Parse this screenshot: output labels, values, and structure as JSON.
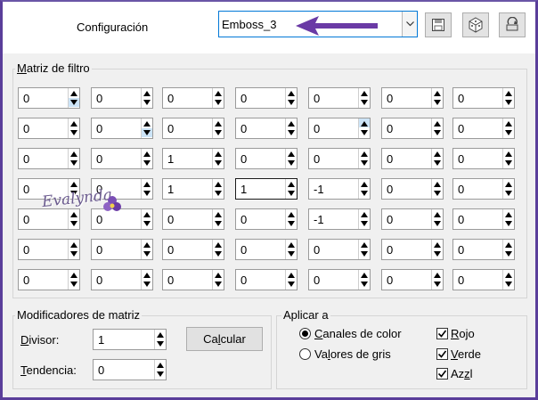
{
  "toolbar": {
    "config_label": "Configuración",
    "preset_value": "Emboss_3",
    "save_icon": "save-icon",
    "random_icon": "dice-icon",
    "reset_icon": "reset-icon"
  },
  "matrix": {
    "title": "Matriz de filtro",
    "rows": [
      [
        "0",
        "0",
        "0",
        "0",
        "0",
        "0",
        "0"
      ],
      [
        "0",
        "0",
        "0",
        "0",
        "0",
        "0",
        "0"
      ],
      [
        "0",
        "0",
        "1",
        "0",
        "0",
        "0",
        "0"
      ],
      [
        "0",
        "0",
        "1",
        "1",
        "-1",
        "0",
        "0"
      ],
      [
        "0",
        "0",
        "0",
        "0",
        "-1",
        "0",
        "0"
      ],
      [
        "0",
        "0",
        "0",
        "0",
        "0",
        "0",
        "0"
      ],
      [
        "0",
        "0",
        "0",
        "0",
        "0",
        "0",
        "0"
      ]
    ]
  },
  "modifiers": {
    "title": "Modificadores de matriz",
    "divisor_label": "Divisor:",
    "divisor_value": "1",
    "bias_label": "Tendencia:",
    "bias_value": "0",
    "calc_button": "Calcular"
  },
  "apply": {
    "title": "Aplicar a",
    "radios": [
      {
        "label": "Canales de color",
        "selected": true
      },
      {
        "label": "Valores de gris",
        "selected": false
      }
    ],
    "checks": [
      {
        "label": "Rojo",
        "checked": true
      },
      {
        "label": "Verde",
        "checked": true
      },
      {
        "label": "Azul",
        "checked": true
      }
    ]
  },
  "watermark": {
    "text": "Evalynda"
  },
  "colors": {
    "frame": "#5a3e9a",
    "annotation_arrow": "#6a3aa5",
    "focus": "#0078d7"
  }
}
